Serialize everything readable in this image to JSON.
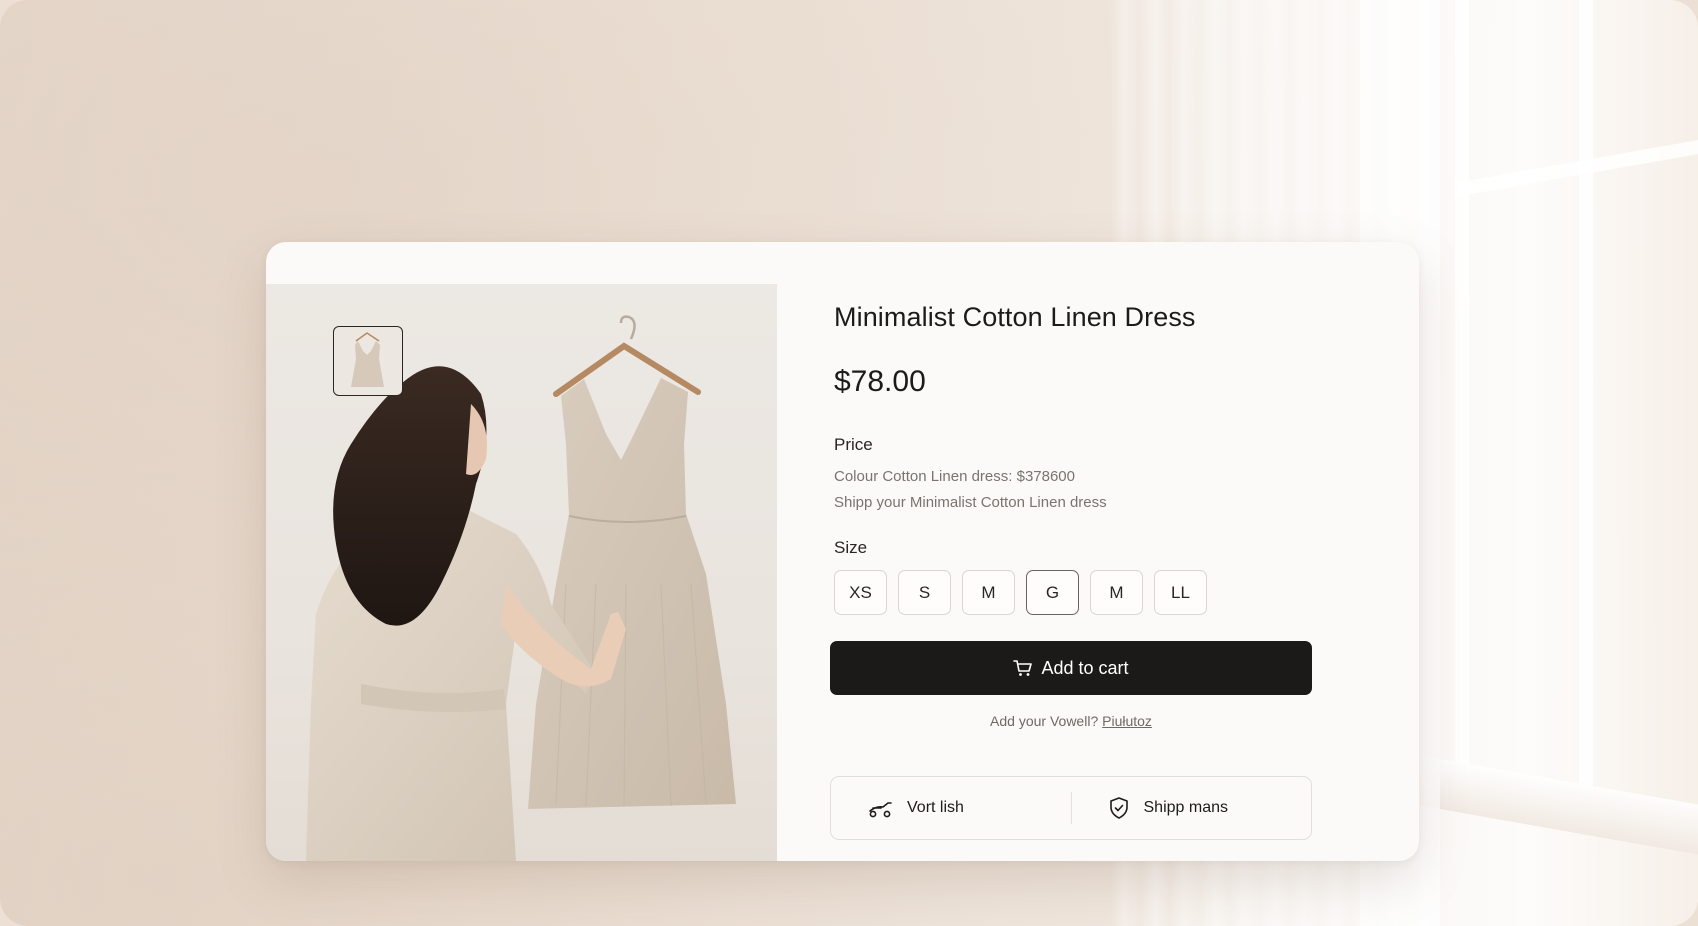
{
  "product": {
    "title": "Minimalist Cotton Linen Dress",
    "price": "$78.00",
    "price_section_label": "Price",
    "description_lines": [
      "Colour Cotton Linen dress: $378600",
      "Shipp your Minimalist Cotton Linen dress"
    ],
    "size_section_label": "Size",
    "sizes": [
      {
        "label": "XS",
        "selected": false
      },
      {
        "label": "S",
        "selected": false
      },
      {
        "label": "M",
        "selected": false
      },
      {
        "label": "G",
        "selected": true
      },
      {
        "label": "M",
        "selected": false
      },
      {
        "label": "LL",
        "selected": false
      }
    ],
    "add_to_cart_label": "Add to cart",
    "help_text": "Add your Vowell?",
    "help_link": "Piułutoz",
    "features": [
      {
        "icon": "scooter-icon",
        "label": "Vort lish"
      },
      {
        "icon": "shield-check-icon",
        "label": "Shipp mans"
      }
    ]
  },
  "gallery": {
    "thumbnail_icon": "dress-thumbnail",
    "main_image": "woman-holding-linen-dress-on-hanger"
  },
  "colors": {
    "button_background": "#1b1a19",
    "card_background": "#fbfaf9",
    "selected_size_border": "#6a645f"
  }
}
